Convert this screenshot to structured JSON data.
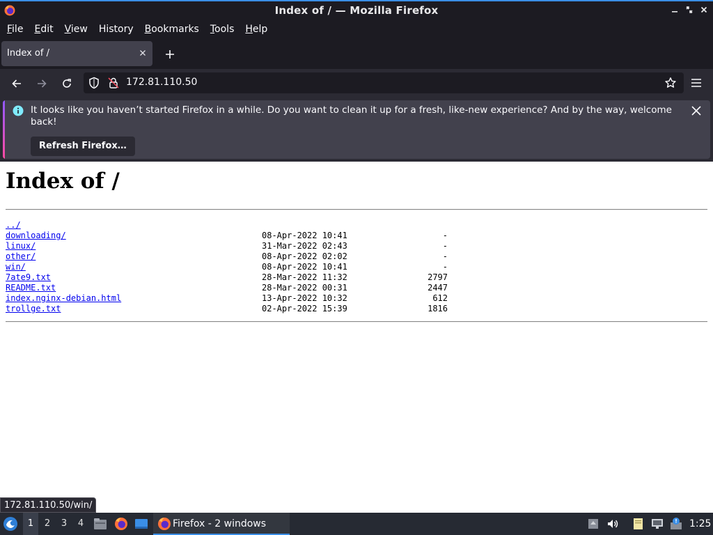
{
  "window": {
    "title": "Index of / — Mozilla Firefox"
  },
  "menubar": {
    "items": [
      {
        "first": "F",
        "rest": "ile"
      },
      {
        "first": "E",
        "rest": "dit"
      },
      {
        "first": "V",
        "rest": "iew"
      },
      {
        "first": "H",
        "rest": "istory",
        "pre": "",
        "u_index": 1
      },
      {
        "first": "B",
        "rest": "ookmarks"
      },
      {
        "first": "T",
        "rest": "ools"
      },
      {
        "first": "H",
        "rest": "elp"
      }
    ],
    "labels": [
      "File",
      "Edit",
      "View",
      "History",
      "Bookmarks",
      "Tools",
      "Help"
    ]
  },
  "tabs": [
    {
      "label": "Index of /"
    }
  ],
  "navbar": {
    "url": "172.81.110.50"
  },
  "notification": {
    "message": "It looks like you haven’t started Firefox in a while. Do you want to clean it up for a fresh, like-new experience? And by the way, welcome back!",
    "button_label": "Refresh Firefox…"
  },
  "page": {
    "heading": "Index of /",
    "entries": [
      {
        "name": "../",
        "date": "",
        "size": ""
      },
      {
        "name": "downloading/",
        "date": "08-Apr-2022 10:41",
        "size": "-"
      },
      {
        "name": "linux/",
        "date": "31-Mar-2022 02:43",
        "size": "-"
      },
      {
        "name": "other/",
        "date": "08-Apr-2022 02:02",
        "size": "-"
      },
      {
        "name": "win/",
        "date": "08-Apr-2022 10:41",
        "size": "-"
      },
      {
        "name": "7ate9.txt",
        "date": "28-Mar-2022 11:32",
        "size": "2797"
      },
      {
        "name": "README.txt",
        "date": "28-Mar-2022 00:31",
        "size": "2447"
      },
      {
        "name": "index.nginx-debian.html",
        "date": "13-Apr-2022 10:32",
        "size": "612"
      },
      {
        "name": "trollge.txt",
        "date": "02-Apr-2022 15:39",
        "size": "1816"
      }
    ]
  },
  "status": {
    "link_preview": "172.81.110.50/win/"
  },
  "taskbar": {
    "workspaces": [
      "1",
      "2",
      "3",
      "4"
    ],
    "active_workspace": "1",
    "task_label": "Firefox - 2 windows",
    "clock": "1:25"
  },
  "colors": {
    "accent": "#3a8ee6",
    "link": "#0000ee"
  }
}
